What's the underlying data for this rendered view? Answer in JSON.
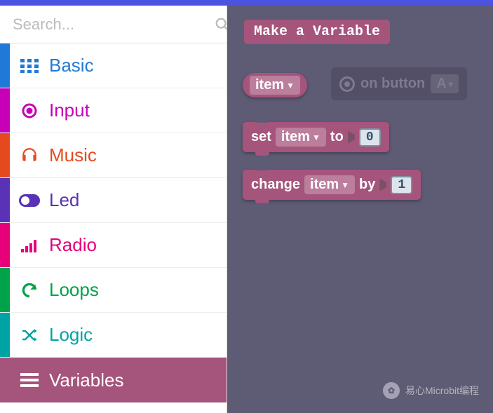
{
  "search": {
    "placeholder": "Search..."
  },
  "categories": {
    "basic": "Basic",
    "input": "Input",
    "music": "Music",
    "led": "Led",
    "radio": "Radio",
    "loops": "Loops",
    "logic": "Logic",
    "variables": "Variables"
  },
  "canvas": {
    "make_variable": "Make a Variable",
    "item_label": "item",
    "on_button": "on button",
    "button_value": "A",
    "set": "set",
    "to": "to",
    "set_value": "0",
    "change": "change",
    "by": "by",
    "change_value": "1"
  },
  "watermark": {
    "icon": "✿",
    "text": "易心Microbit编程"
  }
}
